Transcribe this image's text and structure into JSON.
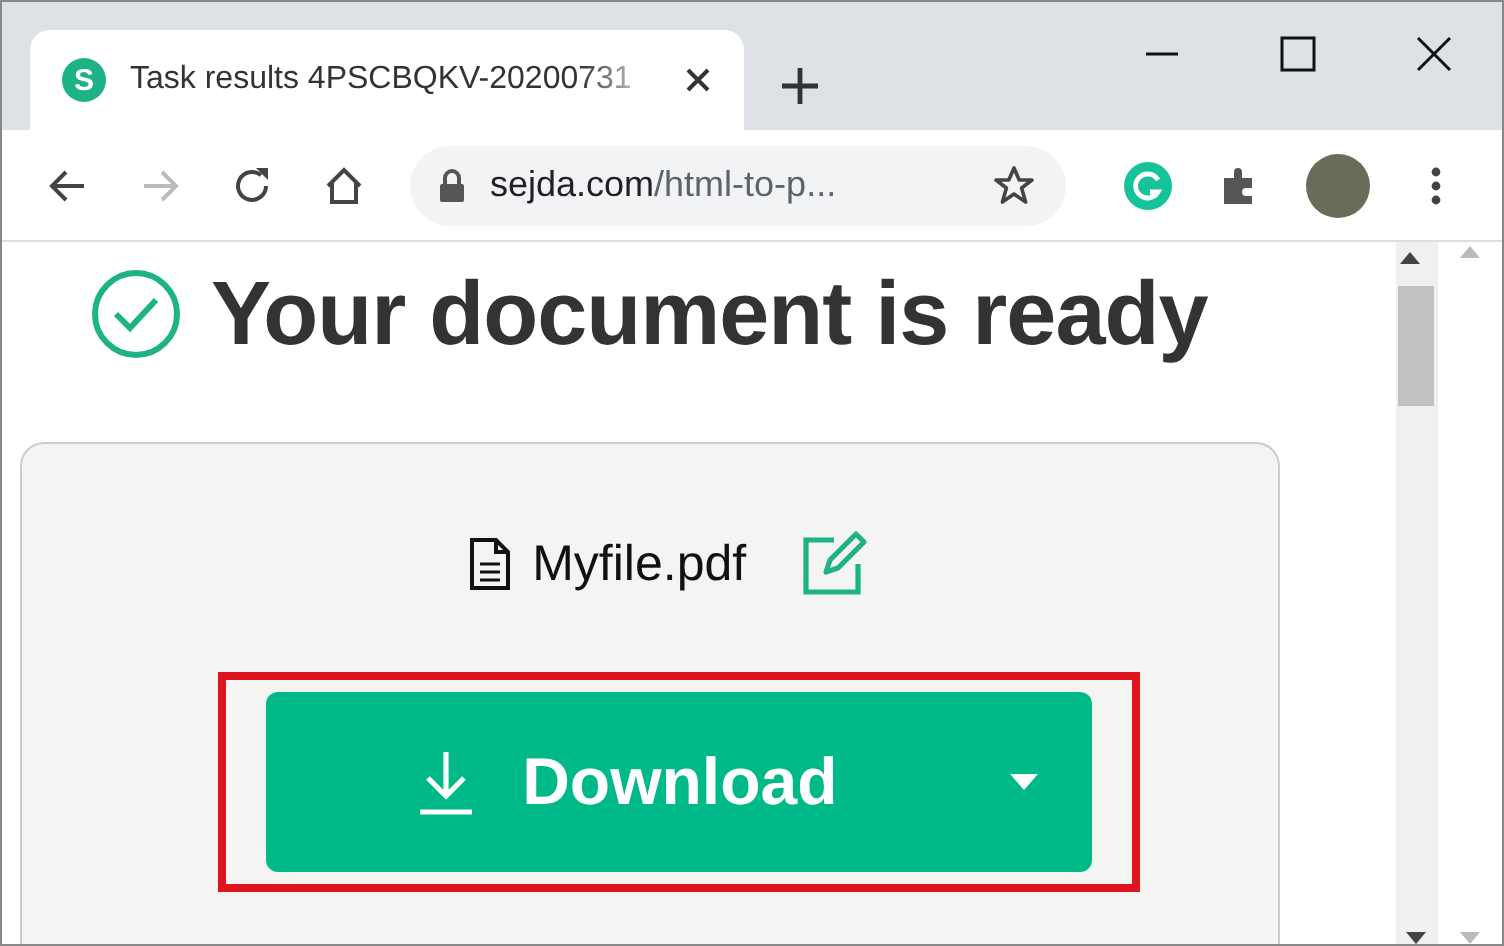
{
  "tab": {
    "favicon": "S",
    "title": "Task results 4PSCBQKV-20200731"
  },
  "address_bar": {
    "domain": "sejda.com",
    "path": "/html-to-p..."
  },
  "page": {
    "heading": "Your document is ready",
    "file_name": "Myfile.pdf",
    "download_button": "Download",
    "highlighted": true
  }
}
